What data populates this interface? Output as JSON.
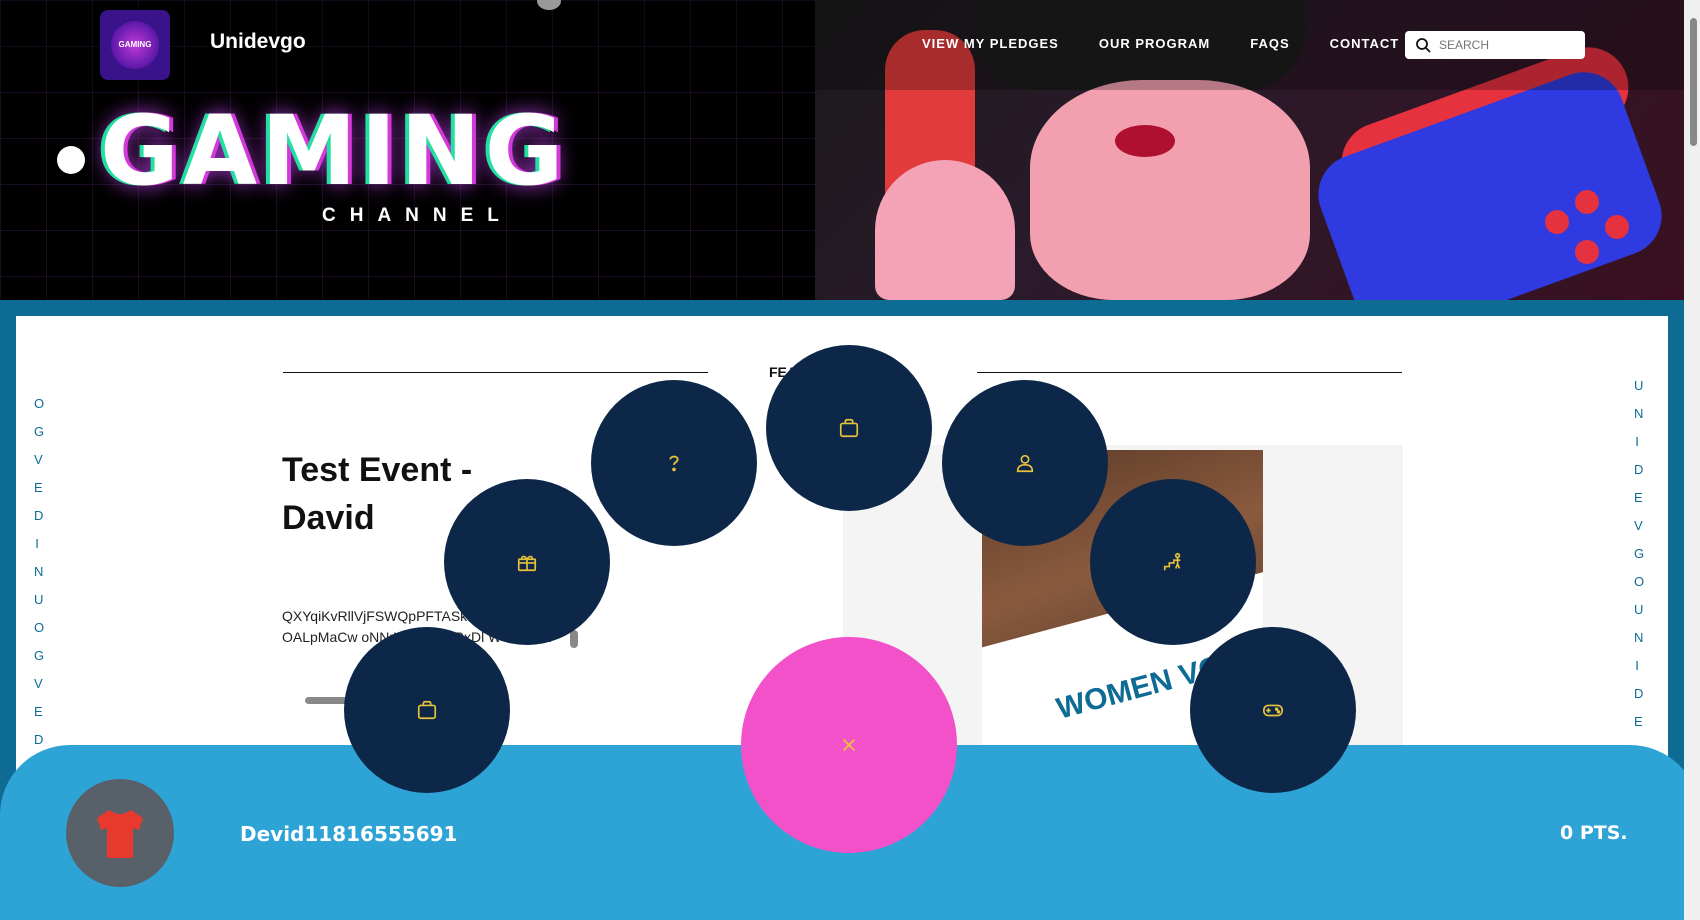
{
  "header": {
    "brand": "Unidevgo",
    "logo_text": "GAMING",
    "nav": [
      "VIEW MY PLEDGES",
      "OUR PROGRAM",
      "FAQS",
      "CONTACT"
    ],
    "search_placeholder": "SEARCH"
  },
  "hero": {
    "title": "GAMING",
    "subtitle": "CHANNEL"
  },
  "side_text": {
    "left": "OGVEDINU OGVEDINU OGV",
    "right": "UNIDEVGO UNIDE"
  },
  "main": {
    "section_heading": "FEATURED EVENTS",
    "event_title": "Test Event - David",
    "description": "QXYqiKvRllVjFSWQpPFTASk JdaVnxEl zLJnP OALpMaCw oNNrW RsFUyRxDl WGXejtDv",
    "image_text": "WOMEN VOLLEYBALL"
  },
  "radial_menu": [
    {
      "name": "gift-icon"
    },
    {
      "name": "question-icon"
    },
    {
      "name": "bag-icon"
    },
    {
      "name": "user-icon"
    },
    {
      "name": "progress-icon"
    },
    {
      "name": "bag-icon"
    },
    {
      "name": "gamepad-icon"
    },
    {
      "name": "close-icon"
    }
  ],
  "user_bar": {
    "username": "Devid11816555691",
    "points": "0 PTS."
  },
  "colors": {
    "frame": "#0e6b93",
    "bottom_bar": "#2ea4d6",
    "bubble": "#0d2748",
    "close_bubble": "#f251c9",
    "icon": "#e8c33a"
  }
}
